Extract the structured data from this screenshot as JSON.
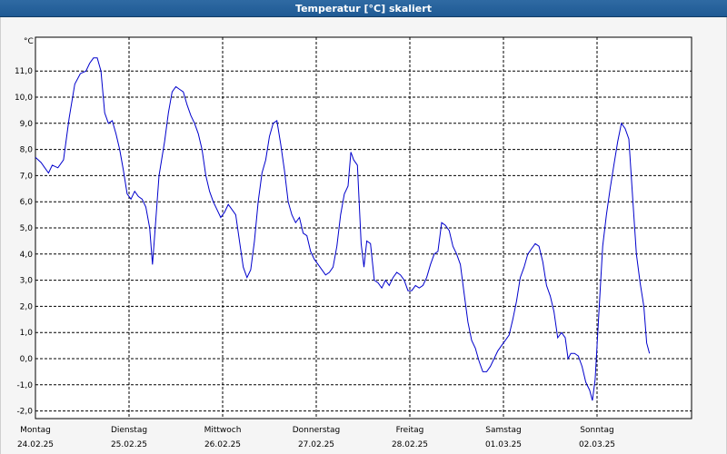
{
  "window": {
    "title": "Temperatur [°C] skaliert"
  },
  "chart_data": {
    "type": "line",
    "title": "Temperatur [°C] skaliert",
    "unit_label": "°C",
    "xlabel": "",
    "ylabel": "",
    "ylim": [
      -2.25,
      12.25
    ],
    "xlim": [
      0,
      7
    ],
    "y_ticks": [
      "11,0",
      "10,0",
      "9,0",
      "8,0",
      "7,0",
      "6,0",
      "5,0",
      "4,0",
      "3,0",
      "2,0",
      "1,0",
      "0,0",
      "-1,0",
      "-2,0"
    ],
    "y_tick_values": [
      11,
      10,
      9,
      8,
      7,
      6,
      5,
      4,
      3,
      2,
      1,
      0,
      -1,
      -2
    ],
    "x_ticks": [
      {
        "day": "Montag",
        "date": "24.02.25"
      },
      {
        "day": "Dienstag",
        "date": "25.02.25"
      },
      {
        "day": "Mittwoch",
        "date": "26.02.25"
      },
      {
        "day": "Donnerstag",
        "date": "27.02.25"
      },
      {
        "day": "Freitag",
        "date": "28.02.25"
      },
      {
        "day": "Samstag",
        "date": "01.03.25"
      },
      {
        "day": "Sonntag",
        "date": "02.03.25"
      }
    ],
    "grid": true,
    "line_color": "#0000cc",
    "series": [
      {
        "name": "",
        "points": [
          [
            0.0,
            7.7
          ],
          [
            0.06,
            7.5
          ],
          [
            0.1,
            7.3
          ],
          [
            0.14,
            7.1
          ],
          [
            0.18,
            7.4
          ],
          [
            0.24,
            7.3
          ],
          [
            0.3,
            7.6
          ],
          [
            0.36,
            9.2
          ],
          [
            0.42,
            10.5
          ],
          [
            0.48,
            10.9
          ],
          [
            0.54,
            11.0
          ],
          [
            0.58,
            11.3
          ],
          [
            0.62,
            11.5
          ],
          [
            0.66,
            11.5
          ],
          [
            0.7,
            11.0
          ],
          [
            0.74,
            9.4
          ],
          [
            0.78,
            9.0
          ],
          [
            0.82,
            9.1
          ],
          [
            0.86,
            8.6
          ],
          [
            0.9,
            8.0
          ],
          [
            0.94,
            7.2
          ],
          [
            0.98,
            6.3
          ],
          [
            1.02,
            6.1
          ],
          [
            1.06,
            6.4
          ],
          [
            1.1,
            6.2
          ],
          [
            1.14,
            6.1
          ],
          [
            1.18,
            5.8
          ],
          [
            1.22,
            5.0
          ],
          [
            1.25,
            3.6
          ],
          [
            1.28,
            5.0
          ],
          [
            1.32,
            7.0
          ],
          [
            1.38,
            8.3
          ],
          [
            1.42,
            9.4
          ],
          [
            1.46,
            10.2
          ],
          [
            1.5,
            10.4
          ],
          [
            1.54,
            10.3
          ],
          [
            1.58,
            10.2
          ],
          [
            1.62,
            9.7
          ],
          [
            1.66,
            9.3
          ],
          [
            1.7,
            9.0
          ],
          [
            1.74,
            8.6
          ],
          [
            1.78,
            8.0
          ],
          [
            1.82,
            7.0
          ],
          [
            1.86,
            6.4
          ],
          [
            1.9,
            6.0
          ],
          [
            1.94,
            5.7
          ],
          [
            1.98,
            5.4
          ],
          [
            2.02,
            5.6
          ],
          [
            2.06,
            5.9
          ],
          [
            2.1,
            5.7
          ],
          [
            2.14,
            5.5
          ],
          [
            2.18,
            4.5
          ],
          [
            2.22,
            3.5
          ],
          [
            2.26,
            3.1
          ],
          [
            2.3,
            3.4
          ],
          [
            2.34,
            4.5
          ],
          [
            2.38,
            6.0
          ],
          [
            2.42,
            7.1
          ],
          [
            2.46,
            7.6
          ],
          [
            2.5,
            8.5
          ],
          [
            2.54,
            9.0
          ],
          [
            2.58,
            9.1
          ],
          [
            2.62,
            8.2
          ],
          [
            2.66,
            7.2
          ],
          [
            2.7,
            6.0
          ],
          [
            2.74,
            5.5
          ],
          [
            2.78,
            5.2
          ],
          [
            2.82,
            5.4
          ],
          [
            2.86,
            4.8
          ],
          [
            2.9,
            4.7
          ],
          [
            2.94,
            4.1
          ],
          [
            2.98,
            3.8
          ],
          [
            3.02,
            3.6
          ],
          [
            3.06,
            3.4
          ],
          [
            3.1,
            3.2
          ],
          [
            3.14,
            3.3
          ],
          [
            3.18,
            3.5
          ],
          [
            3.22,
            4.3
          ],
          [
            3.26,
            5.5
          ],
          [
            3.3,
            6.3
          ],
          [
            3.34,
            6.6
          ],
          [
            3.37,
            7.9
          ],
          [
            3.4,
            7.6
          ],
          [
            3.44,
            7.4
          ],
          [
            3.48,
            4.4
          ],
          [
            3.51,
            3.5
          ],
          [
            3.54,
            4.5
          ],
          [
            3.58,
            4.4
          ],
          [
            3.62,
            3.0
          ],
          [
            3.66,
            2.9
          ],
          [
            3.7,
            2.7
          ],
          [
            3.74,
            3.0
          ],
          [
            3.78,
            2.8
          ],
          [
            3.82,
            3.1
          ],
          [
            3.86,
            3.3
          ],
          [
            3.9,
            3.2
          ],
          [
            3.94,
            3.0
          ],
          [
            3.98,
            2.6
          ],
          [
            4.02,
            2.6
          ],
          [
            4.06,
            2.8
          ],
          [
            4.1,
            2.7
          ],
          [
            4.14,
            2.8
          ],
          [
            4.18,
            3.1
          ],
          [
            4.22,
            3.6
          ],
          [
            4.26,
            4.0
          ],
          [
            4.3,
            4.1
          ],
          [
            4.34,
            5.2
          ],
          [
            4.38,
            5.1
          ],
          [
            4.42,
            4.9
          ],
          [
            4.46,
            4.3
          ],
          [
            4.5,
            4.0
          ],
          [
            4.54,
            3.6
          ],
          [
            4.58,
            2.5
          ],
          [
            4.62,
            1.4
          ],
          [
            4.66,
            0.7
          ],
          [
            4.7,
            0.4
          ],
          [
            4.74,
            -0.1
          ],
          [
            4.78,
            -0.5
          ],
          [
            4.82,
            -0.5
          ],
          [
            4.86,
            -0.3
          ],
          [
            4.9,
            0.0
          ],
          [
            4.94,
            0.3
          ],
          [
            4.98,
            0.5
          ],
          [
            5.02,
            0.7
          ],
          [
            5.06,
            0.9
          ],
          [
            5.1,
            1.5
          ],
          [
            5.14,
            2.2
          ],
          [
            5.18,
            3.1
          ],
          [
            5.22,
            3.5
          ],
          [
            5.26,
            4.0
          ],
          [
            5.3,
            4.2
          ],
          [
            5.34,
            4.4
          ],
          [
            5.38,
            4.3
          ],
          [
            5.42,
            3.7
          ],
          [
            5.46,
            2.8
          ],
          [
            5.5,
            2.4
          ],
          [
            5.54,
            1.8
          ],
          [
            5.58,
            0.8
          ],
          [
            5.62,
            1.0
          ],
          [
            5.66,
            0.8
          ],
          [
            5.69,
            0.0
          ],
          [
            5.72,
            0.2
          ],
          [
            5.76,
            0.2
          ],
          [
            5.8,
            0.1
          ],
          [
            5.84,
            -0.3
          ],
          [
            5.88,
            -0.9
          ],
          [
            5.92,
            -1.2
          ],
          [
            5.95,
            -1.6
          ],
          [
            5.98,
            -0.8
          ],
          [
            6.02,
            1.8
          ],
          [
            6.06,
            4.3
          ],
          [
            6.1,
            5.5
          ],
          [
            6.14,
            6.5
          ],
          [
            6.18,
            7.4
          ],
          [
            6.22,
            8.3
          ],
          [
            6.26,
            9.0
          ],
          [
            6.3,
            8.8
          ],
          [
            6.34,
            8.4
          ],
          [
            6.38,
            6.2
          ],
          [
            6.42,
            4.0
          ],
          [
            6.46,
            2.9
          ],
          [
            6.5,
            2.0
          ],
          [
            6.53,
            0.6
          ],
          [
            6.56,
            0.2
          ]
        ]
      }
    ]
  }
}
